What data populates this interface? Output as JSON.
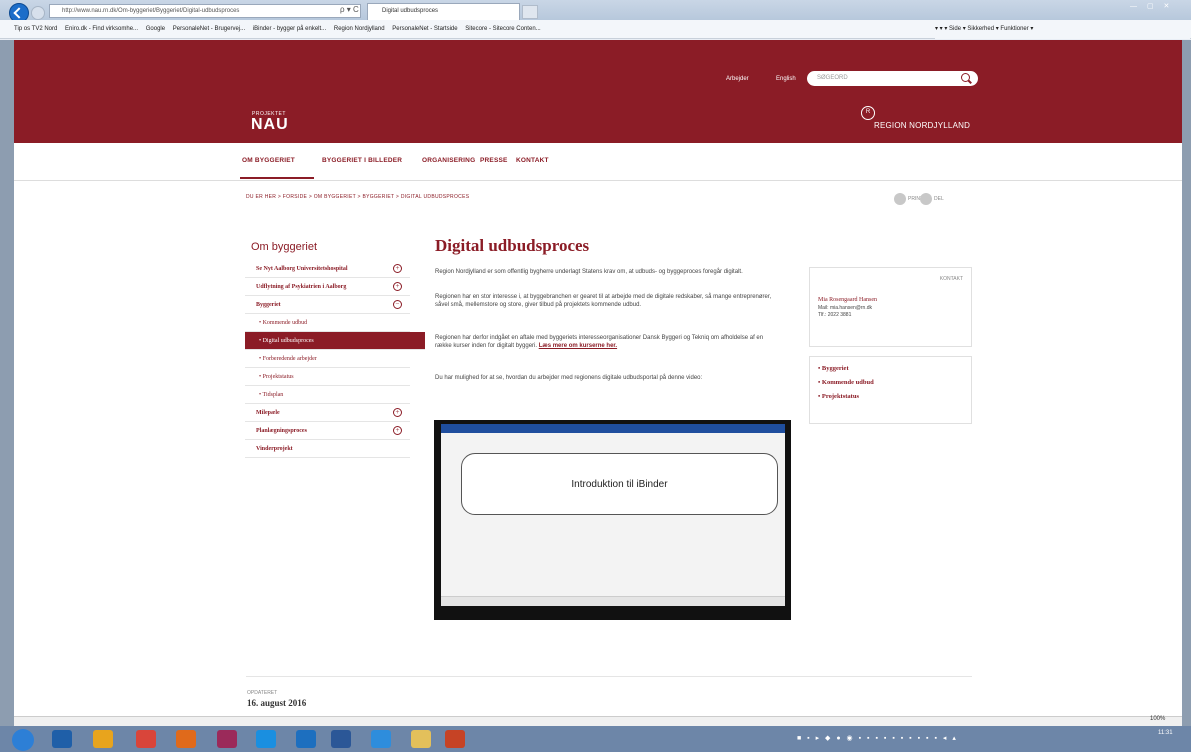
{
  "browser": {
    "address": "http://www.nau.rn.dk/Om-byggeriet/Byggeriet/Digital-udbudsproces",
    "tab_title": "Digital udbudsproces",
    "addr_tools": "ρ ▾ C",
    "win_controls": "— ▢ ✕",
    "favorites": [
      "Tip os TV2 Nord",
      "Eniro.dk - Find virksomhe...",
      "Google",
      "PersonaleNet - Brugervej...",
      "iBinder - bygger på enkelt...",
      "Region Nordjylland",
      "PersonaleNet - Startside",
      "Sitecore - Sitecore Conten..."
    ],
    "commands": "▾  ▾  ▾  Side ▾  Sikkerhed ▾  Funktioner ▾",
    "zoom": "100%"
  },
  "header": {
    "top_link_1": "Arbejder",
    "top_link_2": "English",
    "search_placeholder": "SØGEORD",
    "logo_small": "PROJEKTET",
    "logo_big": "NAU",
    "region_emblem": "R",
    "region_name": "REGION NORDJYLLAND"
  },
  "nav": [
    "OM BYGGERIET",
    "BYGGERIET I BILLEDER",
    "ORGANISERING",
    "PRESSE",
    "KONTAKT"
  ],
  "breadcrumb": "DU ER HER  >  FORSIDE  >  OM BYGGERIET  >  BYGGERIET  >  DIGITAL UDBUDSPROCES",
  "tools": {
    "print": "PRINT",
    "share": "DEL"
  },
  "sidebar": {
    "title": "Om byggeriet",
    "items": [
      {
        "label": "Se Nyt Aalborg Universitetshospital",
        "toggle": "+"
      },
      {
        "label": "Udflytning af Psykiatrien i Aalborg",
        "toggle": "+"
      },
      {
        "label": "Byggeriet",
        "toggle": "−"
      },
      {
        "label": "• Kommende udbud"
      },
      {
        "label": "• Digital udbudsproces"
      },
      {
        "label": "• Forberedende arbejder"
      },
      {
        "label": "• Projektstatus"
      },
      {
        "label": "• Tidsplan"
      },
      {
        "label": "Milepæle",
        "toggle": "+"
      },
      {
        "label": "Planlægningsproces",
        "toggle": "+"
      },
      {
        "label": "Vinderprojekt"
      }
    ]
  },
  "main": {
    "title": "Digital udbudsproces",
    "p1": "Region Nordjylland er som offentlig bygherre underlagt Statens krav om, at udbuds- og byggeproces foregår digitalt.",
    "p2": "Regionen har en stor interesse i, at byggebranchen er gearet til at arbejde med de digitale redskaber, så mange entreprenører, såvel små, mellemstore og store, giver tilbud på projektets kommende udbud.",
    "p3": "Regionen har derfor indgået en aftale med byggeriets interesseorganisationer Dansk Byggeri og Tekniq om afholdelse af en række kurser inden for digitalt byggeri.",
    "p3_link": "Læs mere om kurserne her.",
    "p4": "Du har mulighed for at se, hvordan du arbejder med regionens digitale udbudsportal på denne video:",
    "video_title": "Introduktion til iBinder"
  },
  "contact": {
    "label": "KONTAKT",
    "name": "Mia Rosengaard Hansen",
    "mail": "Mail: mia.hansen@rn.dk",
    "tel": "Tlf.: 2022 3881"
  },
  "related": [
    "• Byggeriet",
    "• Kommende udbud",
    "• Projektstatus"
  ],
  "footer": {
    "updated_label": "OPDATERET",
    "updated_date": "16. august 2016"
  },
  "taskbar": {
    "clock": "11:31",
    "tray": "■ ▪ ▸ ◆ ● ◉ ▪ ▪ ▪ ▪ ▪ ▪ ▪ ▪ ▪ ▪ ◂ ▴"
  }
}
